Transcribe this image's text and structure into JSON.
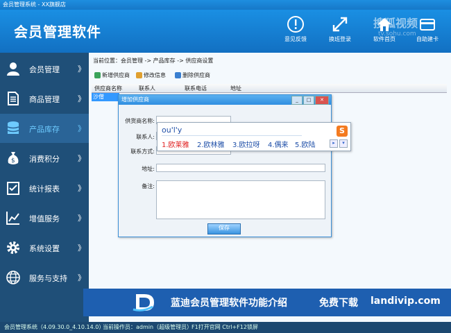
{
  "window": {
    "title": "会员管理系统 - XX旗舰店"
  },
  "header": {
    "app_title": "会员管理软件",
    "buttons": [
      {
        "label": "意见反馈",
        "icon": "info-icon"
      },
      {
        "label": "换班登录",
        "icon": "swap-arrows-icon"
      },
      {
        "label": "软件首页",
        "icon": "home-icon"
      },
      {
        "label": "自助建卡",
        "icon": "card-icon"
      }
    ],
    "watermark": "搜狐视频",
    "watermark_url": "tv.sohu.com"
  },
  "sidebar": {
    "items": [
      {
        "label": "会员管理",
        "icon": "user-icon",
        "active": false
      },
      {
        "label": "商品管理",
        "icon": "document-icon",
        "active": false
      },
      {
        "label": "产品库存",
        "icon": "database-icon",
        "active": true
      },
      {
        "label": "消费积分",
        "icon": "money-bag-icon",
        "active": false
      },
      {
        "label": "统计报表",
        "icon": "checklist-icon",
        "active": false
      },
      {
        "label": "增值服务",
        "icon": "chart-icon",
        "active": false
      },
      {
        "label": "系统设置",
        "icon": "gear-icon",
        "active": false
      },
      {
        "label": "服务与支持",
        "icon": "globe-icon",
        "active": false
      }
    ],
    "chevron": "》"
  },
  "main": {
    "breadcrumb": "当前位置：会员管理 -> 产品库存 -> 供应商设置",
    "toolbar": {
      "add": "新增供应商",
      "edit": "修改信息",
      "delete": "删除供应商"
    },
    "columns": [
      "供应商名称",
      "联系人",
      "联系电话",
      "地址"
    ],
    "selected_row": "沙僧"
  },
  "dialog": {
    "title": "增加供应商",
    "fields": {
      "supplier_name": "供货商名称:",
      "contact": "联系人:",
      "phone": "联系方式:",
      "address": "地址:",
      "remark": "备注:"
    },
    "save": "保存"
  },
  "ime": {
    "typed": "ou'l'y",
    "candidates": [
      "1.欧莱雅",
      "2.欧林雅",
      "3.欧拉呀",
      "4.偶来",
      "5.欧陆"
    ],
    "logo": "S"
  },
  "banner": {
    "text1": "蓝迪会员管理软件功能介绍",
    "text2": "免费下载",
    "text3": "landivip.com"
  },
  "status": {
    "version": "会员管理系统（4.09.30.0_4.10.14.0）",
    "operator": "当前操作员：admin（超级管理员）",
    "hotkeys": "F1打开官网 Ctrl+F12锁屏"
  },
  "colors": {
    "header": "#1a8fe3",
    "sidebar": "#1f4f78",
    "accent": "#3399ff",
    "candidate_first": "#e02020",
    "banner": "#1e5fb0"
  }
}
